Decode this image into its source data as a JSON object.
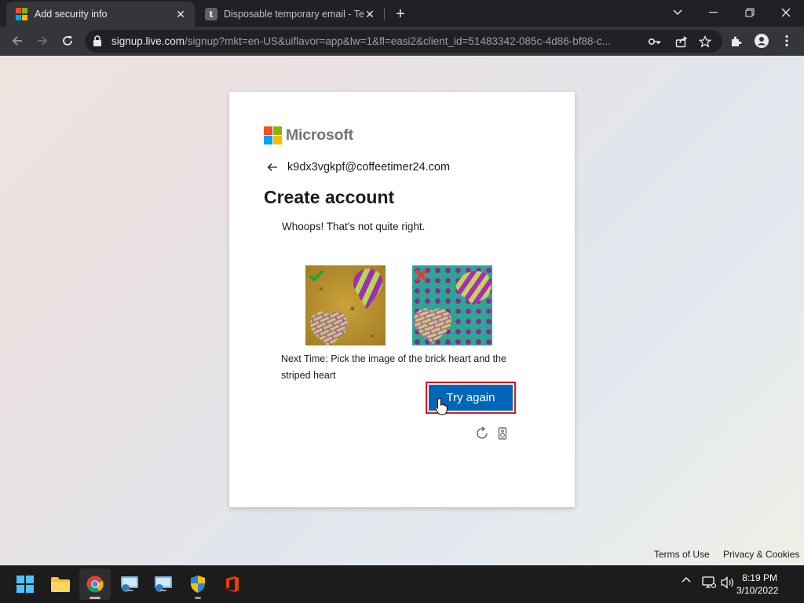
{
  "browser": {
    "tabs": [
      {
        "title": "Add security info",
        "active": true
      },
      {
        "title": "Disposable temporary email - Ter",
        "active": false
      }
    ],
    "url_host": "signup.live.com",
    "url_rest": "/signup?mkt=en-US&uiflavor=app&lw=1&fl=easi2&client_id=51483342-085c-4d86-bf88-c..."
  },
  "card": {
    "brand": "Microsoft",
    "identity": "k9dx3vgkpf@coffeetimer24.com",
    "title": "Create account",
    "message": "Whoops! That's not quite right.",
    "hint": "Next Time: Pick the image of the brick heart and the striped heart",
    "try_again": "Try again"
  },
  "footer": {
    "terms": "Terms of Use",
    "privacy": "Privacy & Cookies"
  },
  "taskbar": {
    "apps": [
      "windows-start",
      "file-explorer",
      "chrome",
      "remote-desktop-1",
      "remote-desktop-2",
      "windows-security",
      "office"
    ],
    "time": "8:19 PM",
    "date": "3/10/2022"
  },
  "colors": {
    "accent": "#0067b8",
    "error_border": "#d71920",
    "ms_red": "#f25022",
    "ms_green": "#7fba00",
    "ms_blue": "#00a4ef",
    "ms_yellow": "#ffb900"
  }
}
